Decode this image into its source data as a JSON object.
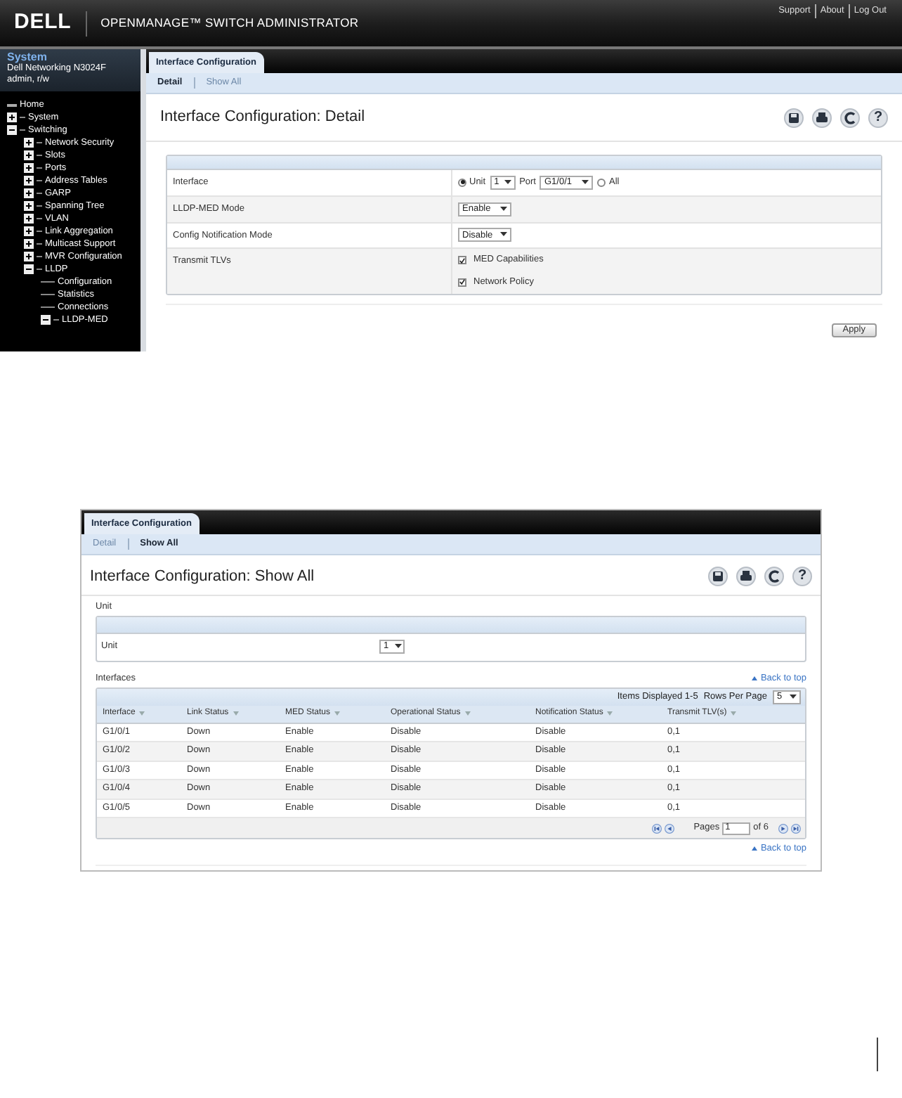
{
  "detail_screen": {
    "header": {
      "logo": "DELL",
      "product": "OPENMANAGE™ SWITCH ADMINISTRATOR",
      "links": [
        "Support",
        "About",
        "Log Out"
      ]
    },
    "sidebar": {
      "title": "System",
      "device": "Dell Networking N3024F",
      "user": "admin, r/w",
      "tree": [
        {
          "label": "Home"
        },
        {
          "label": "System",
          "expanded": false
        },
        {
          "label": "Switching",
          "expanded": true,
          "children": [
            {
              "label": "Network Security",
              "expanded": false
            },
            {
              "label": "Slots",
              "expanded": false
            },
            {
              "label": "Ports",
              "expanded": false
            },
            {
              "label": "Address Tables",
              "expanded": false
            },
            {
              "label": "GARP",
              "expanded": false
            },
            {
              "label": "Spanning Tree",
              "expanded": false
            },
            {
              "label": "VLAN",
              "expanded": false
            },
            {
              "label": "Link Aggregation",
              "expanded": false
            },
            {
              "label": "Multicast Support",
              "expanded": false
            },
            {
              "label": "MVR Configuration",
              "expanded": false
            },
            {
              "label": "LLDP",
              "expanded": true,
              "children": [
                {
                  "label": "Configuration"
                },
                {
                  "label": "Statistics"
                },
                {
                  "label": "Connections"
                },
                {
                  "label": "LLDP-MED",
                  "expanded": true
                }
              ]
            }
          ]
        }
      ]
    },
    "tab": "Interface Configuration",
    "subtabs": [
      {
        "label": "Detail",
        "selected": true
      },
      {
        "label": "Show All",
        "selected": false
      }
    ],
    "title": "Interface Configuration: Detail",
    "toolbar": [
      {
        "kind": "save"
      },
      {
        "kind": "print"
      },
      {
        "kind": "refresh"
      },
      {
        "kind": "help",
        "glyph": "?"
      }
    ],
    "form": [
      {
        "label": "Interface",
        "kind": "interface",
        "unit_radio": {
          "label": "Unit",
          "selected": true
        },
        "unit": "1",
        "port_label": "Port",
        "port": "G1/0/1",
        "all_radio": {
          "label": "All",
          "selected": false
        }
      },
      {
        "label": "LLDP-MED Mode",
        "kind": "select",
        "value": "Enable"
      },
      {
        "label": "Config Notification Mode",
        "kind": "select",
        "value": "Disable"
      },
      {
        "label": "Transmit TLVs",
        "kind": "checkboxes",
        "options": [
          {
            "label": "MED Capabilities",
            "checked": true
          },
          {
            "label": "Network Policy",
            "checked": true
          }
        ]
      }
    ],
    "apply": "Apply"
  },
  "show_all_screen": {
    "tab": "Interface Configuration",
    "subtabs": [
      {
        "label": "Detail",
        "selected": false
      },
      {
        "label": "Show All",
        "selected": true
      }
    ],
    "title": "Interface Configuration: Show All",
    "toolbar": [
      {
        "kind": "save"
      },
      {
        "kind": "print"
      },
      {
        "kind": "refresh"
      },
      {
        "kind": "help",
        "glyph": "?"
      }
    ],
    "unit_section": {
      "heading": "Unit",
      "label": "Unit",
      "value": "1"
    },
    "interfaces_heading": "Interfaces",
    "back_to_top": [
      "Back to top",
      "Back to top"
    ],
    "items_displayed": "Items Displayed 1-5",
    "rows_per_page_label": "Rows Per Page",
    "rows_per_page": "5",
    "table": {
      "columns": [
        "Interface",
        "Link Status",
        "MED Status",
        "Operational Status",
        "Notification Status",
        "Transmit TLV(s)"
      ],
      "rows": [
        [
          "G1/0/1",
          "Down",
          "Enable",
          "Disable",
          "Disable",
          "0,1"
        ],
        [
          "G1/0/2",
          "Down",
          "Enable",
          "Disable",
          "Disable",
          "0,1"
        ],
        [
          "G1/0/3",
          "Down",
          "Enable",
          "Disable",
          "Disable",
          "0,1"
        ],
        [
          "G1/0/4",
          "Down",
          "Enable",
          "Disable",
          "Disable",
          "0,1"
        ],
        [
          "G1/0/5",
          "Down",
          "Enable",
          "Disable",
          "Disable",
          "0,1"
        ]
      ]
    },
    "pager": {
      "label": "Pages",
      "page": "1",
      "of": "of 6"
    }
  }
}
